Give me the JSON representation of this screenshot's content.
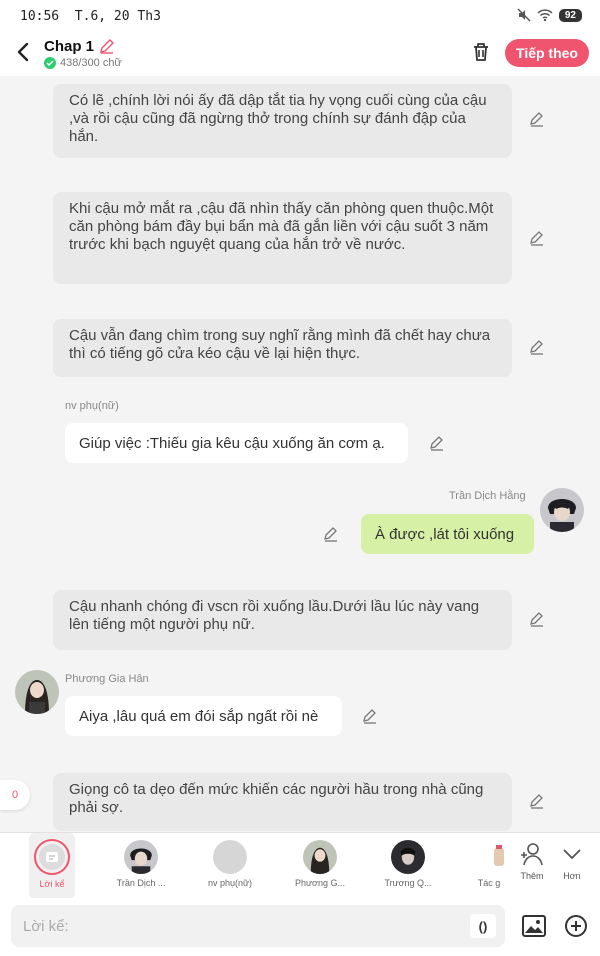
{
  "status": {
    "time": "10:56",
    "date": "T.6, 20 Th3",
    "battery": "92"
  },
  "header": {
    "title": "Chap 1",
    "word_count": "438/300 chữ",
    "next_label": "Tiếp theo"
  },
  "messages": {
    "n1": "Có lẽ ,chính lời nói ấy đã dập tắt tia hy vọng cuối cùng của cậu ,và rồi cậu cũng đã ngừng thở trong chính sự đánh đập của hắn.",
    "n2": "Khi cậu mở mắt ra ,cậu đã nhìn thấy căn phòng quen thuộc.Một căn phòng bám đầy bụi bẩn mà đã gắn liền với cậu suốt 3 năm trước khi bạch nguyệt quang của hắn trở về nước.",
    "n3": "Cậu vẫn đang chìm trong suy nghĩ rằng mình đã chết hay chưa thì có tiếng gõ cửa kéo cậu về lại hiện thực.",
    "c1_name": "nv phụ(nữ)",
    "c1_text": "Giúp việc :Thiếu gia kêu cậu xuống ăn cơm ạ.",
    "c2_name": "Trần Dịch Hằng",
    "c2_text": "À được ,lát tôi xuống",
    "n4": "Cậu nhanh chóng đi vscn rồi xuống lầu.Dưới lầu lúc này vang lên tiếng một người phụ nữ.",
    "c3_name": "Phương Gia Hân",
    "c3_text": "Aiya ,lâu quá em đói sắp ngất rồi nè",
    "n5": "Giọng cô ta dẹo đến mức khiến các người hầu trong nhà cũng phải sợ."
  },
  "side_count": "0",
  "characters": [
    {
      "label": "Lời kể"
    },
    {
      "label": "Trần Dịch ..."
    },
    {
      "label": "nv phụ(nữ)"
    },
    {
      "label": "Phương G..."
    },
    {
      "label": "Trương Q..."
    },
    {
      "label": "Tác g"
    }
  ],
  "tools": {
    "more": "Thêm",
    "collapse": "Hơn"
  },
  "composer": {
    "placeholder": "Lời kể:",
    "paren": "()"
  },
  "colors": {
    "accent": "#f0556f",
    "green_bubble": "#d6f0a6",
    "narration_bg": "#e9e9e9"
  }
}
